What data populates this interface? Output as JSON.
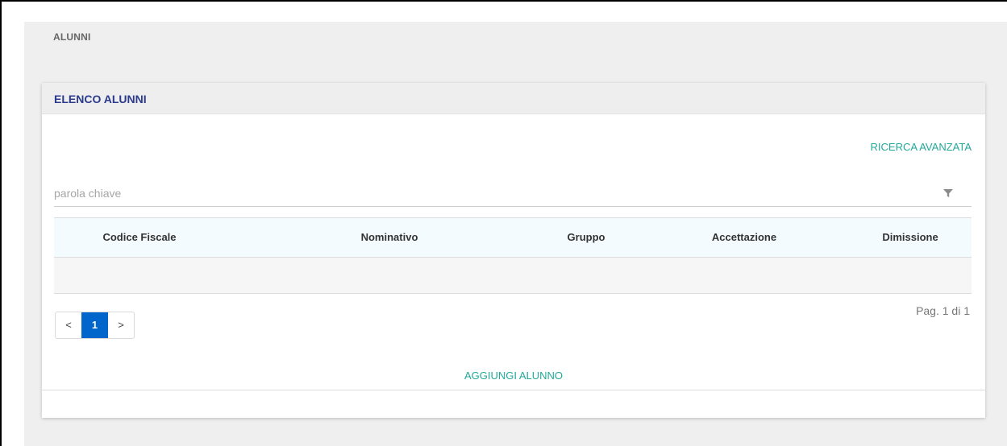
{
  "page": {
    "heading": "ALUNNI"
  },
  "card": {
    "title": "ELENCO ALUNNI",
    "advanced_search_label": "RICERCA AVANZATA"
  },
  "search": {
    "placeholder": "parola chiave",
    "value": ""
  },
  "table": {
    "columns": [
      "Codice Fiscale",
      "Nominativo",
      "Gruppo",
      "Accettazione",
      "Dimissione"
    ],
    "rows": []
  },
  "pagination": {
    "prev_label": "<",
    "current_page": "1",
    "next_label": ">",
    "info": "Pag. 1 di 1"
  },
  "actions": {
    "add_label": "AGGIUNGI ALUNNO"
  },
  "colors": {
    "accent_teal": "#22a99a",
    "title_blue": "#2b3a8c",
    "active_page_blue": "#0066cc",
    "header_row_bg": "#f3fbff"
  },
  "icons": {
    "filter": "filter-icon"
  }
}
